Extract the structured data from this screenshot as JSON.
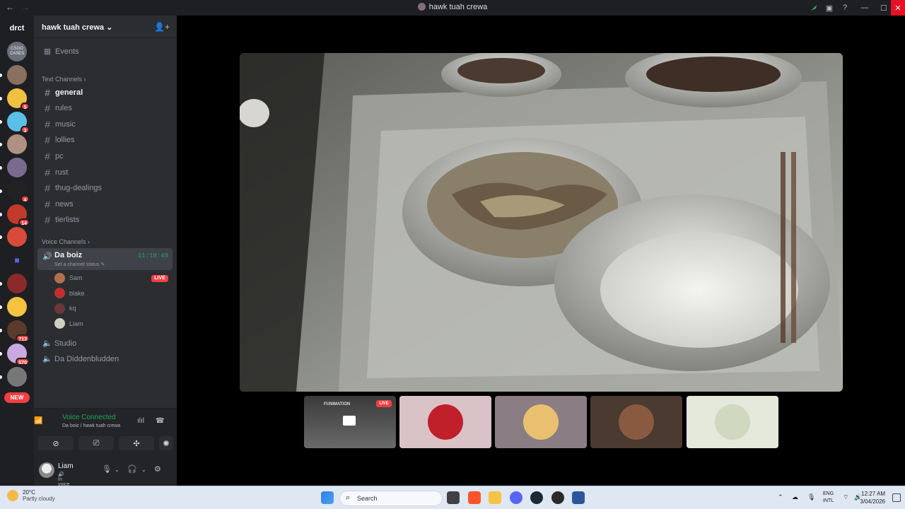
{
  "window": {
    "title": "hawk tuah crewa"
  },
  "rail": {
    "home_label": "drct",
    "servers": [
      {
        "name": "csgo-cases",
        "label": "CSGO CASES",
        "badge": ""
      },
      {
        "name": "server-2",
        "label": "",
        "badge": ""
      },
      {
        "name": "server-3",
        "label": "",
        "badge": "5"
      },
      {
        "name": "server-4",
        "label": "",
        "badge": "3"
      },
      {
        "name": "server-5",
        "label": "",
        "badge": ""
      },
      {
        "name": "server-6",
        "label": "",
        "badge": ""
      },
      {
        "name": "server-7",
        "label": "",
        "badge": "4"
      },
      {
        "name": "server-8",
        "label": "",
        "badge": "14"
      },
      {
        "name": "server-9",
        "label": "",
        "badge": ""
      },
      {
        "name": "folder",
        "label": "",
        "badge": ""
      },
      {
        "name": "server-11",
        "label": "",
        "badge": ""
      },
      {
        "name": "server-12",
        "label": "",
        "badge": ""
      },
      {
        "name": "server-13",
        "label": "",
        "badge": "713"
      },
      {
        "name": "server-14",
        "label": "",
        "badge": "570"
      },
      {
        "name": "server-15",
        "label": "",
        "badge": ""
      }
    ],
    "new_label": "NEW"
  },
  "server": {
    "name": "hawk tuah crewa",
    "events_label": "Events",
    "text_category": "Text Channels",
    "text_channels": [
      "general",
      "rules",
      "music",
      "lollies",
      "pc",
      "rust",
      "thug-dealings",
      "news",
      "tierlists"
    ],
    "voice_category": "Voice Channels",
    "voice_channel": {
      "name": "Da boiz",
      "timer": "11:18:49",
      "status": "Set a channel status",
      "members": [
        "Sam",
        "blake",
        "kq",
        "Liam"
      ],
      "live_label": "LIVE"
    },
    "other_voice": [
      "Studio",
      "Da Diddenbludden"
    ]
  },
  "voice_panel": {
    "status": "Voice Connected",
    "location": "Da boiz / hawk tuah crewa"
  },
  "user": {
    "name": "Liam",
    "status": "In voice"
  },
  "stage": {
    "tiles": [
      {
        "name": "stream-tile",
        "label": "FUNIMATION",
        "live": "LIVE"
      },
      {
        "name": "user-tile-2"
      },
      {
        "name": "user-tile-3"
      },
      {
        "name": "user-tile-4"
      },
      {
        "name": "user-tile-5"
      }
    ]
  },
  "taskbar": {
    "temp": "20°C",
    "condition": "Partly cloudy",
    "search_placeholder": "Search",
    "lang_1": "ENG",
    "lang_2": "INTL",
    "time": "12:27 AM",
    "date": "3/04/2026"
  }
}
